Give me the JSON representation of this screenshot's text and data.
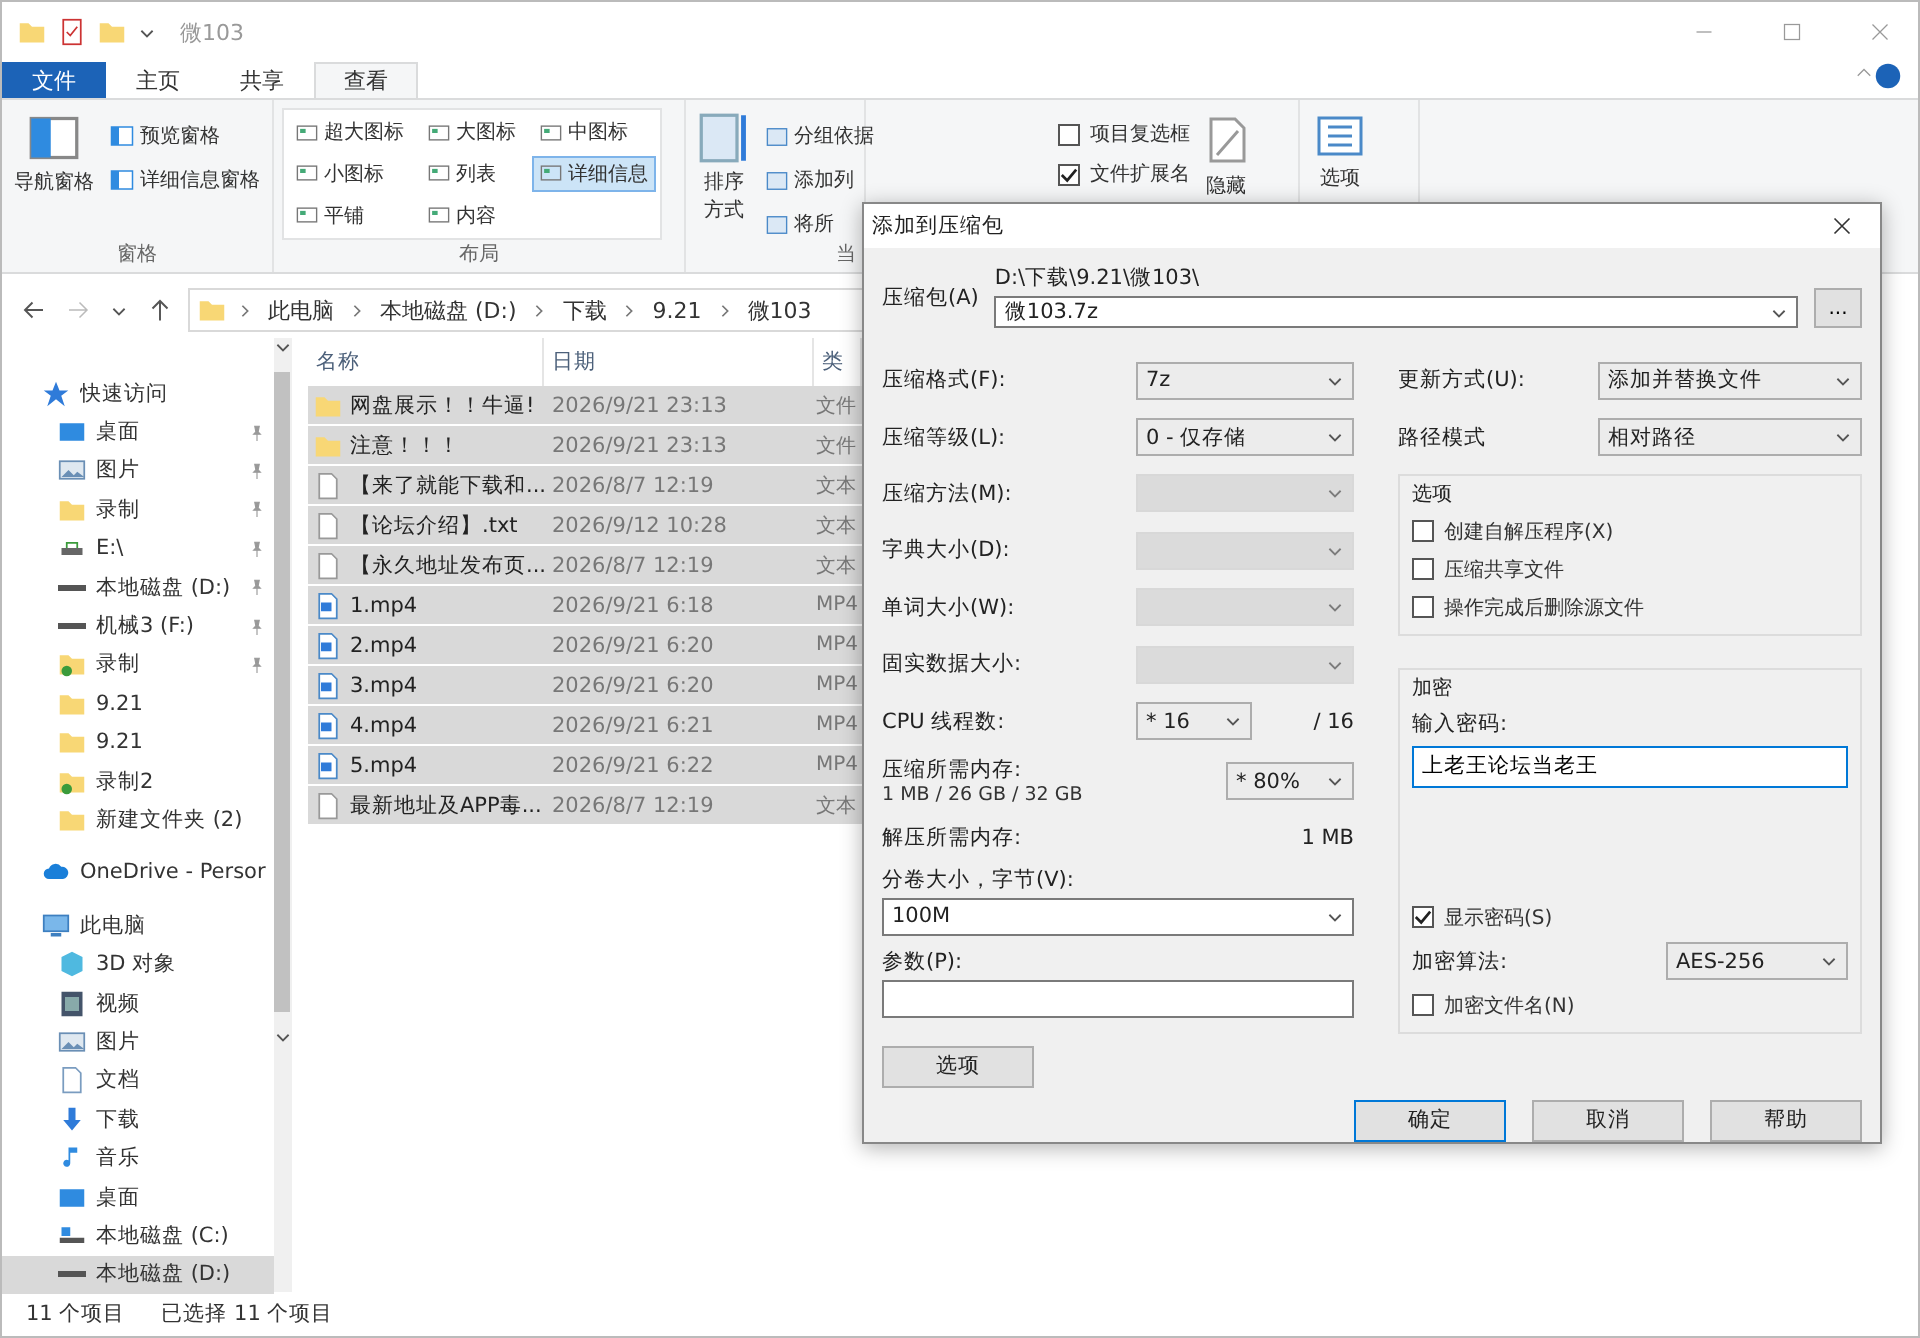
{
  "window": {
    "title": "微103"
  },
  "ribbon_tabs": [
    {
      "label": "文件",
      "selected": false,
      "kind": "file"
    },
    {
      "label": "主页",
      "selected": false,
      "kind": "tab"
    },
    {
      "label": "共享",
      "selected": false,
      "kind": "tab"
    },
    {
      "label": "查看",
      "selected": true,
      "kind": "tab"
    }
  ],
  "ribbon": {
    "panes": {
      "label": "窗格",
      "big": "导航窗格",
      "items": [
        "预览窗格",
        "详细信息窗格"
      ]
    },
    "layout": {
      "label": "布局",
      "items": [
        {
          "label": "超大图标",
          "selected": false
        },
        {
          "label": "大图标",
          "selected": false
        },
        {
          "label": "中图标",
          "selected": false
        },
        {
          "label": "小图标",
          "selected": false
        },
        {
          "label": "列表",
          "selected": false
        },
        {
          "label": "详细信息",
          "selected": true
        },
        {
          "label": "平铺",
          "selected": false
        },
        {
          "label": "内容",
          "selected": false
        }
      ]
    },
    "current_view": {
      "label": "当",
      "big": "排序方式",
      "items": [
        "分组依据",
        "添加列",
        "将所"
      ]
    },
    "show_hide": {
      "checks": [
        {
          "label": "项目复选框",
          "checked": false
        },
        {
          "label": "文件扩展名",
          "checked": true
        }
      ],
      "hide": "隐藏"
    },
    "options": "选项"
  },
  "address": {
    "path": [
      "此电脑",
      "本地磁盘 (D:)",
      "下载",
      "9.21",
      "微103"
    ]
  },
  "sidebar": {
    "items": [
      {
        "label": "快速访问",
        "kind": "star",
        "selected": false,
        "children": [
          {
            "label": "桌面",
            "kind": "desktop",
            "pinned": true,
            "selected": false
          },
          {
            "label": "图片",
            "kind": "pictures",
            "pinned": true,
            "selected": false
          },
          {
            "label": "录制",
            "kind": "folder",
            "pinned": true,
            "selected": false
          },
          {
            "label": "E:\\",
            "kind": "netdrive",
            "pinned": true,
            "selected": false
          },
          {
            "label": "本地磁盘 (D:)",
            "kind": "drive",
            "pinned": true,
            "selected": false
          },
          {
            "label": "机械3 (F:)",
            "kind": "drive",
            "pinned": true,
            "selected": false
          },
          {
            "label": "录制",
            "kind": "shared",
            "pinned": true,
            "selected": false
          },
          {
            "label": "9.21",
            "kind": "folder",
            "pinned": false,
            "selected": false
          },
          {
            "label": "9.21",
            "kind": "folder",
            "pinned": false,
            "selected": false
          },
          {
            "label": "录制2",
            "kind": "shared",
            "pinned": false,
            "selected": false
          },
          {
            "label": "新建文件夹 (2)",
            "kind": "folder",
            "pinned": false,
            "selected": false
          }
        ]
      },
      {
        "label": "OneDrive - Persor",
        "kind": "cloud",
        "selected": false
      },
      {
        "label": "此电脑",
        "kind": "pc",
        "selected": false,
        "children": [
          {
            "label": "3D 对象",
            "kind": "cube",
            "pinned": false,
            "selected": false
          },
          {
            "label": "视频",
            "kind": "video",
            "pinned": false,
            "selected": false
          },
          {
            "label": "图片",
            "kind": "pictures",
            "pinned": false,
            "selected": false
          },
          {
            "label": "文档",
            "kind": "docs",
            "pinned": false,
            "selected": false
          },
          {
            "label": "下载",
            "kind": "download",
            "pinned": false,
            "selected": false
          },
          {
            "label": "音乐",
            "kind": "music",
            "pinned": false,
            "selected": false
          },
          {
            "label": "桌面",
            "kind": "desktop",
            "pinned": false,
            "selected": false
          },
          {
            "label": "本地磁盘 (C:)",
            "kind": "sysdrive",
            "pinned": false,
            "selected": false
          },
          {
            "label": "本地磁盘 (D:)",
            "kind": "drive",
            "pinned": false,
            "selected": true
          }
        ]
      }
    ]
  },
  "table": {
    "columns": [
      "名称",
      "日期",
      "类"
    ],
    "rows": [
      {
        "name": "网盘展示！！牛逼!",
        "date": "2026/9/21 23:13",
        "type": "文件",
        "kind": "folder",
        "selected": true
      },
      {
        "name": "注意！！！",
        "date": "2026/9/21 23:13",
        "type": "文件",
        "kind": "folder",
        "selected": true
      },
      {
        "name": "【来了就能下载和...",
        "date": "2026/8/7 12:19",
        "type": "文本",
        "kind": "text",
        "selected": true
      },
      {
        "name": "【论坛介绍】.txt",
        "date": "2026/9/12 10:28",
        "type": "文本",
        "kind": "text",
        "selected": true
      },
      {
        "name": "【永久地址发布页...",
        "date": "2026/8/7 12:19",
        "type": "文本",
        "kind": "text",
        "selected": true
      },
      {
        "name": "1.mp4",
        "date": "2026/9/21 6:18",
        "type": "MP4",
        "kind": "video",
        "selected": true
      },
      {
        "name": "2.mp4",
        "date": "2026/9/21 6:20",
        "type": "MP4",
        "kind": "video",
        "selected": true
      },
      {
        "name": "3.mp4",
        "date": "2026/9/21 6:20",
        "type": "MP4",
        "kind": "video",
        "selected": true
      },
      {
        "name": "4.mp4",
        "date": "2026/9/21 6:21",
        "type": "MP4",
        "kind": "video",
        "selected": true
      },
      {
        "name": "5.mp4",
        "date": "2026/9/21 6:22",
        "type": "MP4",
        "kind": "video",
        "selected": true
      },
      {
        "name": "最新地址及APP毒...",
        "date": "2026/8/7 12:19",
        "type": "文本",
        "kind": "text",
        "selected": true
      }
    ]
  },
  "status_bar": {
    "count": "11 个项目",
    "selected": "已选择 11 个项目"
  },
  "dialog": {
    "title": "添加到压缩包",
    "archive": {
      "label": "压缩包(A)",
      "path": "D:\\下载\\9.21\\微103\\",
      "value": "微103.7z",
      "browse": "..."
    },
    "fields": [
      {
        "label": "压缩格式(F):",
        "value": "7z",
        "disabled": false
      },
      {
        "label": "压缩等级(L):",
        "value": "0 - 仅存储",
        "disabled": false
      },
      {
        "label": "压缩方法(M):",
        "disabled": true
      },
      {
        "label": "字典大小(D):",
        "disabled": true
      },
      {
        "label": "单词大小(W):",
        "disabled": true
      },
      {
        "label": "固实数据大小:",
        "disabled": true
      }
    ],
    "cpu": {
      "label": "CPU 线程数:",
      "value": "* 16",
      "total": "/ 16"
    },
    "memory": {
      "label": "压缩所需内存:",
      "detail": "1 MB / 26 GB / 32 GB",
      "value": "* 80%"
    },
    "decompress": {
      "label": "解压所需内存:",
      "value": "1 MB"
    },
    "split": {
      "label": "分卷大小，字节(V):",
      "value": "100M"
    },
    "params": {
      "label": "参数(P):"
    },
    "options_button": "选项",
    "update": {
      "label": "更新方式(U):",
      "value": "添加并替换文件"
    },
    "path_mode": {
      "label": "路径模式",
      "value": "相对路径"
    },
    "options": {
      "title": "选项",
      "checks": [
        {
          "label": "创建自解压程序(X)",
          "checked": false
        },
        {
          "label": "压缩共享文件",
          "checked": false
        },
        {
          "label": "操作完成后删除源文件",
          "checked": false
        }
      ]
    },
    "encryption": {
      "title": "加密",
      "password_label": "输入密码:",
      "password": "上老王论坛当老王",
      "show_password": {
        "label": "显示密码(S)",
        "checked": true
      },
      "method_label": "加密算法:",
      "method": "AES-256",
      "encrypt_names": {
        "label": "加密文件名(N)",
        "checked": false
      }
    },
    "buttons": [
      {
        "label": "确定",
        "default": true
      },
      {
        "label": "取消",
        "default": false
      },
      {
        "label": "帮助",
        "default": false
      }
    ]
  }
}
